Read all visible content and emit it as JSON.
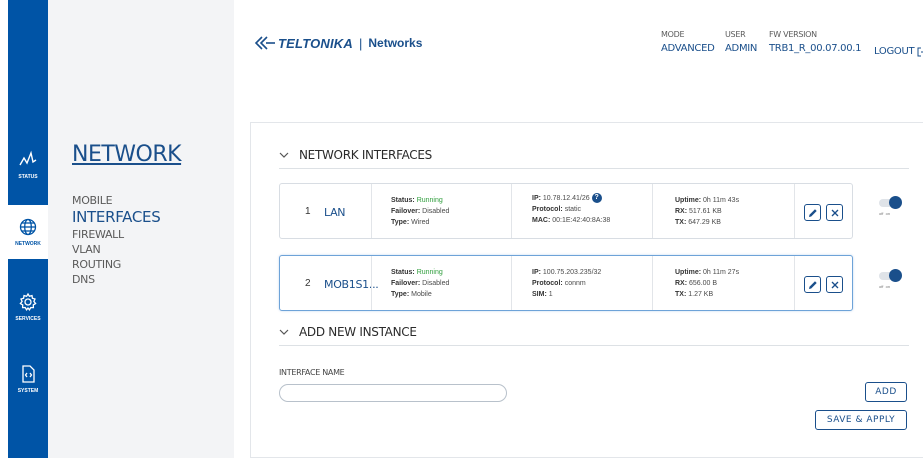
{
  "header": {
    "brand": "TELTONIKA",
    "separator": "|",
    "product": "Networks",
    "mode_label": "MODE",
    "mode_value": "ADVANCED",
    "user_label": "USER",
    "user_value": "ADMIN",
    "fw_label": "FW VERSION",
    "fw_value": "TRB1_R_00.07.00.1",
    "logout_label": "LOGOUT"
  },
  "rail": {
    "items": [
      {
        "label": "STATUS",
        "icon": "status-pulse-icon",
        "active": false
      },
      {
        "label": "NETWORK",
        "icon": "globe-icon",
        "active": true
      },
      {
        "label": "SERVICES",
        "icon": "gear-icon",
        "active": false
      },
      {
        "label": "SYSTEM",
        "icon": "system-icon",
        "active": false
      }
    ]
  },
  "nav": {
    "title": "NETWORK",
    "items": [
      "MOBILE",
      "INTERFACES",
      "FIREWALL",
      "VLAN",
      "ROUTING",
      "DNS"
    ],
    "active": "INTERFACES"
  },
  "sections": {
    "interfaces_title": "NETWORK INTERFACES",
    "add_title": "ADD NEW INSTANCE"
  },
  "interfaces": [
    {
      "index": "1",
      "name": "LAN",
      "status_label": "Status:",
      "status": "Running",
      "failover_label": "Failover:",
      "failover": "Disabled",
      "type_label": "Type:",
      "type": "Wired",
      "ip_label": "IP:",
      "ip": "10.78.12.41/26",
      "protocol_label": "Protocol:",
      "protocol": "static",
      "third_label": "MAC:",
      "third": "00:1E:42:40:8A:38",
      "uptime_label": "Uptime:",
      "uptime": "0h 11m 43s",
      "rx_label": "RX:",
      "rx": "517.61 KB",
      "tx_label": "TX:",
      "tx": "647.29 KB",
      "enabled": true
    },
    {
      "index": "2",
      "name": "MOB1S1...",
      "status_label": "Status:",
      "status": "Running",
      "failover_label": "Failover:",
      "failover": "Disabled",
      "type_label": "Type:",
      "type": "Mobile",
      "ip_label": "IP:",
      "ip": "100.75.203.235/32",
      "protocol_label": "Protocol:",
      "protocol": "connm",
      "third_label": "SIM:",
      "third": "1",
      "uptime_label": "Uptime:",
      "uptime": "0h 11m 27s",
      "rx_label": "RX:",
      "rx": "656.00 B",
      "tx_label": "TX:",
      "tx": "1.27 KB",
      "enabled": true
    }
  ],
  "toggle_labels": {
    "off": "off",
    "on": "on"
  },
  "form": {
    "interface_name_label": "INTERFACE NAME",
    "interface_name_value": "",
    "interface_name_placeholder": "",
    "add_label": "ADD",
    "save_label": "SAVE & APPLY"
  },
  "colors": {
    "brand_blue": "#0054a6",
    "text_blue": "#1a4f8b",
    "running_green": "#2e9d3b",
    "nav_bg": "#f3f4f6"
  }
}
